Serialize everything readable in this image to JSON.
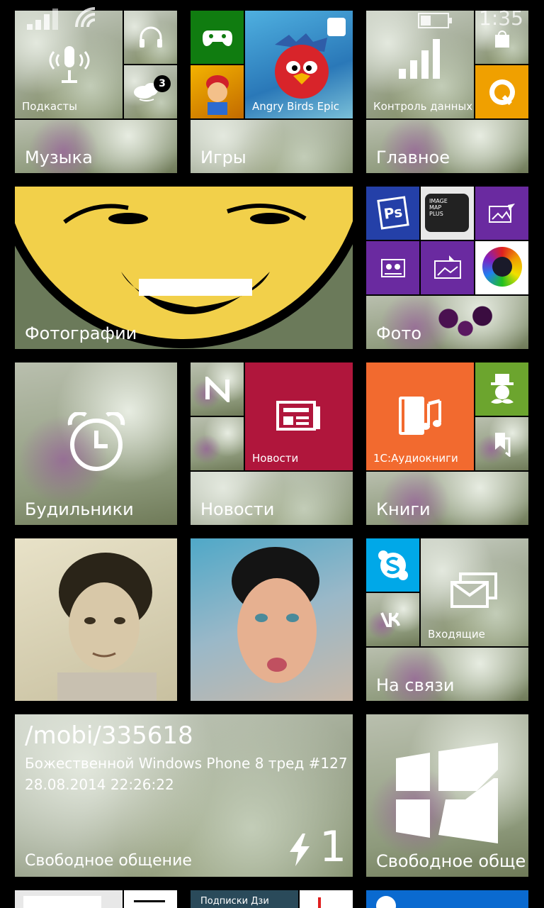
{
  "status_bar": {
    "time": "1:35",
    "icons": [
      "signal-icon",
      "wifi-icon",
      "battery-icon"
    ]
  },
  "tiles": {
    "podcasts": {
      "label": "Подкасты"
    },
    "music": {
      "label": "Музыка"
    },
    "games": {
      "label": "Игры",
      "game_name": "Angry Birds Epic"
    },
    "data_control": {
      "label": "Контроль данных"
    },
    "main": {
      "label": "Главное"
    },
    "podcasts_badge": {
      "count": "3"
    },
    "photos": {
      "label": "Фотографии"
    },
    "photo": {
      "label": "Фото"
    },
    "ps_tile": {
      "text": "Ps"
    },
    "image_map_plus": {
      "line1": "IMAGE",
      "line2": "MAP",
      "line3": "PLUS"
    },
    "alarms": {
      "label": "Будильники"
    },
    "news_small": {
      "label": "Новости"
    },
    "news": {
      "label": "Новости"
    },
    "audiobooks": {
      "label": "1С:Аудиокниги"
    },
    "books": {
      "label": "Книги"
    },
    "inbox": {
      "label": "Входящие"
    },
    "on_touch": {
      "label": "На связи"
    },
    "mobi": {
      "title": "/mobi/335618",
      "subtitle": "Божественной Windows Phone 8 тред #127",
      "datetime": "28.08.2014 22:26:22",
      "label": "Свободное общение",
      "count": "1"
    },
    "free_chat": {
      "label": "Свободное обще"
    },
    "bottom_partial": {
      "text": "Подписки Дзи"
    }
  },
  "colors": {
    "xbox_green": "#107c10",
    "photoshop_blue": "#2440a8",
    "purple": "#6a2aa0",
    "news_red": "#b0163c",
    "orange_books": "#f26a2f",
    "green_tile": "#6ca52e",
    "skype_blue": "#00a8e8",
    "sberbank_orange": "#f0a000"
  }
}
